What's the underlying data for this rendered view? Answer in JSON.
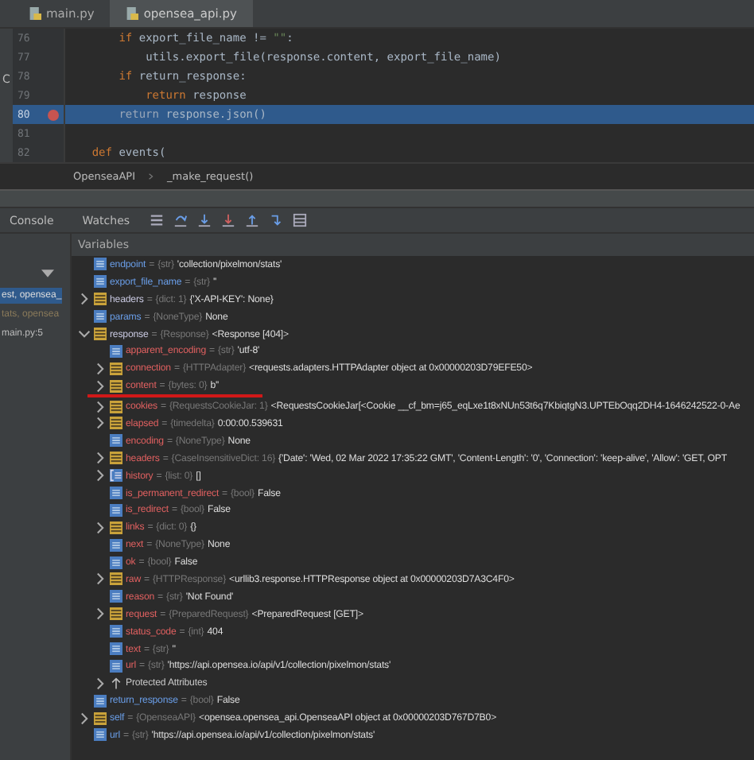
{
  "side_strip": {
    "label": "C"
  },
  "tabs": [
    {
      "label": "main.py",
      "selected": false
    },
    {
      "label": "opensea_api.py",
      "selected": true
    }
  ],
  "code": {
    "body": [
      {
        "number": "76",
        "breakpoint": false,
        "selected": false,
        "tokens": [
          {
            "kind": "keyword",
            "text": "if"
          },
          {
            "kind": "plain",
            "text": " export_file_name != "
          },
          {
            "kind": "string",
            "text": "\"\""
          },
          {
            "kind": "plain",
            "text": ":"
          }
        ],
        "children": [
          {
            "number": "77",
            "breakpoint": false,
            "selected": false,
            "tokens": [
              {
                "kind": "plain",
                "text": "utils.export_file(response.content, export_file_name)"
              }
            ]
          }
        ]
      },
      {
        "number": "78",
        "breakpoint": false,
        "selected": false,
        "tokens": [
          {
            "kind": "keyword",
            "text": "if"
          },
          {
            "kind": "plain",
            "text": " return_response:"
          }
        ],
        "children": [
          {
            "number": "79",
            "breakpoint": false,
            "selected": false,
            "tokens": [
              {
                "kind": "keyword",
                "text": "return"
              },
              {
                "kind": "plain",
                "text": " response"
              }
            ]
          }
        ]
      },
      {
        "number": "80",
        "breakpoint": true,
        "selected": true,
        "tokens": [
          {
            "kind": "keyword",
            "text": "return"
          },
          {
            "kind": "plain",
            "text": " response.json()"
          }
        ]
      },
      {
        "number": "81",
        "breakpoint": false,
        "selected": false
      }
    ],
    "tail": [
      {
        "number": "82",
        "breakpoint": false,
        "selected": false,
        "tokens": [
          {
            "kind": "keyword",
            "text": "def"
          },
          {
            "kind": "plain",
            "text": " events("
          }
        ]
      }
    ]
  },
  "breadcrumbs": [
    "OpenseaAPI",
    "_make_request()"
  ],
  "debug_tabs": [
    {
      "label": "Console",
      "selected": false
    },
    {
      "label": "Watches",
      "selected": false
    }
  ],
  "frames": [
    {
      "label": "est, opensea_",
      "selected": true,
      "dimmed": false
    },
    {
      "label": "tats, opensea",
      "selected": false,
      "dimmed": true
    },
    {
      "label": "main.py:5",
      "selected": false,
      "dimmed": false
    }
  ],
  "variables_title": "Variables",
  "variables": [
    {
      "name": "endpoint",
      "equals": "=",
      "type": "{str}",
      "value": "'collection/pixelmon/stats'",
      "kind": "value",
      "expandable": false,
      "color": "#6a9ee8",
      "underlined": false
    },
    {
      "name": "export_file_name",
      "equals": "=",
      "type": "{str}",
      "value": "''",
      "kind": "value",
      "expandable": false,
      "color": "#6a9ee8",
      "underlined": false
    },
    {
      "name": "headers",
      "equals": "=",
      "type": "{dict: 1}",
      "value": "{'X-API-KEY': None}",
      "kind": "object",
      "expandable": true,
      "expanded": false,
      "color": "#c8c8e0",
      "underlined": false
    },
    {
      "name": "params",
      "equals": "=",
      "type": "{NoneType}",
      "value": "None",
      "kind": "value",
      "expandable": false,
      "color": "#6a9ee8",
      "underlined": false
    },
    {
      "name": "response",
      "equals": "=",
      "type": "{Response}",
      "value": "<Response [404]>",
      "kind": "object",
      "expandable": true,
      "expanded": true,
      "color": "#c8c8e0",
      "underlined": false,
      "children": [
        {
          "name": "apparent_encoding",
          "equals": "=",
          "type": "{str}",
          "value": "'utf-8'",
          "kind": "value",
          "expandable": false,
          "color": "#e06060",
          "underlined": false
        },
        {
          "name": "connection",
          "equals": "=",
          "type": "{HTTPAdapter}",
          "value": "<requests.adapters.HTTPAdapter object at 0x00000203D79EFE50>",
          "kind": "object",
          "expandable": true,
          "expanded": false,
          "color": "#e06060",
          "underlined": false
        },
        {
          "name": "content",
          "equals": "=",
          "type": "{bytes: 0}",
          "value": "b''",
          "kind": "object",
          "expandable": true,
          "expanded": false,
          "color": "#e06060",
          "underlined": true
        },
        {
          "name": "cookies",
          "equals": "=",
          "type": "{RequestsCookieJar: 1}",
          "value": "<RequestsCookieJar[<Cookie __cf_bm=j65_eqLxe1t8xNUn53t6q7KbiqtgN3.UPTEbOqq2DH4-1646242522-0-Ae",
          "kind": "object",
          "expandable": true,
          "expanded": false,
          "color": "#e06060",
          "underlined": false
        },
        {
          "name": "elapsed",
          "equals": "=",
          "type": "{timedelta}",
          "value": "0:00:00.539631",
          "kind": "object",
          "expandable": true,
          "expanded": false,
          "color": "#e06060",
          "underlined": false
        },
        {
          "name": "encoding",
          "equals": "=",
          "type": "{NoneType}",
          "value": "None",
          "kind": "value",
          "expandable": false,
          "color": "#e06060",
          "underlined": false
        },
        {
          "name": "headers",
          "equals": "=",
          "type": "{CaseInsensitiveDict: 16}",
          "value": "{'Date': 'Wed, 02 Mar 2022 17:35:22 GMT', 'Content-Length': '0', 'Connection': 'keep-alive', 'Allow': 'GET, OPT",
          "kind": "object",
          "expandable": true,
          "expanded": false,
          "color": "#e06060",
          "underlined": false
        },
        {
          "name": "history",
          "equals": "=",
          "type": "{list: 0}",
          "value": "[]",
          "kind": "list",
          "expandable": true,
          "expanded": false,
          "color": "#e06060",
          "underlined": false
        },
        {
          "name": "is_permanent_redirect",
          "equals": "=",
          "type": "{bool}",
          "value": "False",
          "kind": "value",
          "expandable": false,
          "color": "#e06060",
          "underlined": false
        },
        {
          "name": "is_redirect",
          "equals": "=",
          "type": "{bool}",
          "value": "False",
          "kind": "value",
          "expandable": false,
          "color": "#e06060",
          "underlined": false
        },
        {
          "name": "links",
          "equals": "=",
          "type": "{dict: 0}",
          "value": "{}",
          "kind": "object",
          "expandable": true,
          "expanded": false,
          "color": "#e06060",
          "underlined": false
        },
        {
          "name": "next",
          "equals": "=",
          "type": "{NoneType}",
          "value": "None",
          "kind": "value",
          "expandable": false,
          "color": "#e06060",
          "underlined": false
        },
        {
          "name": "ok",
          "equals": "=",
          "type": "{bool}",
          "value": "False",
          "kind": "value",
          "expandable": false,
          "color": "#e06060",
          "underlined": false
        },
        {
          "name": "raw",
          "equals": "=",
          "type": "{HTTPResponse}",
          "value": "<urllib3.response.HTTPResponse object at 0x00000203D7A3C4F0>",
          "kind": "object",
          "expandable": true,
          "expanded": false,
          "color": "#e06060",
          "underlined": false
        },
        {
          "name": "reason",
          "equals": "=",
          "type": "{str}",
          "value": "'Not Found'",
          "kind": "value",
          "expandable": false,
          "color": "#e06060",
          "underlined": false
        },
        {
          "name": "request",
          "equals": "=",
          "type": "{PreparedRequest}",
          "value": "<PreparedRequest [GET]>",
          "kind": "object",
          "expandable": true,
          "expanded": false,
          "color": "#e06060",
          "underlined": false
        },
        {
          "name": "status_code",
          "equals": "=",
          "type": "{int}",
          "value": "404",
          "kind": "value",
          "expandable": false,
          "color": "#e06060",
          "underlined": false
        },
        {
          "name": "text",
          "equals": "=",
          "type": "{str}",
          "value": "''",
          "kind": "value",
          "expandable": false,
          "color": "#e06060",
          "underlined": false
        },
        {
          "name": "url",
          "equals": "=",
          "type": "{str}",
          "value": "'https://api.opensea.io/api/v1/collection/pixelmon/stats'",
          "kind": "value",
          "expandable": false,
          "color": "#e06060",
          "underlined": false
        },
        {
          "name": "Protected Attributes",
          "kind": "group",
          "expandable": true,
          "expanded": false,
          "color": "#c8c8c8",
          "underlined": false
        }
      ]
    },
    {
      "name": "return_response",
      "equals": "=",
      "type": "{bool}",
      "value": "False",
      "kind": "value",
      "expandable": false,
      "color": "#6a9ee8",
      "underlined": false
    },
    {
      "name": "self",
      "equals": "=",
      "type": "{OpenseaAPI}",
      "value": "<opensea.opensea_api.OpenseaAPI object at 0x00000203D767D7B0>",
      "kind": "object",
      "expandable": true,
      "expanded": false,
      "color": "#6a9ee8",
      "underlined": false
    },
    {
      "name": "url",
      "equals": "=",
      "type": "{str}",
      "value": "'https://api.opensea.io/api/v1/collection/pixelmon/stats'",
      "kind": "value",
      "expandable": false,
      "color": "#6a9ee8",
      "underlined": false
    }
  ]
}
